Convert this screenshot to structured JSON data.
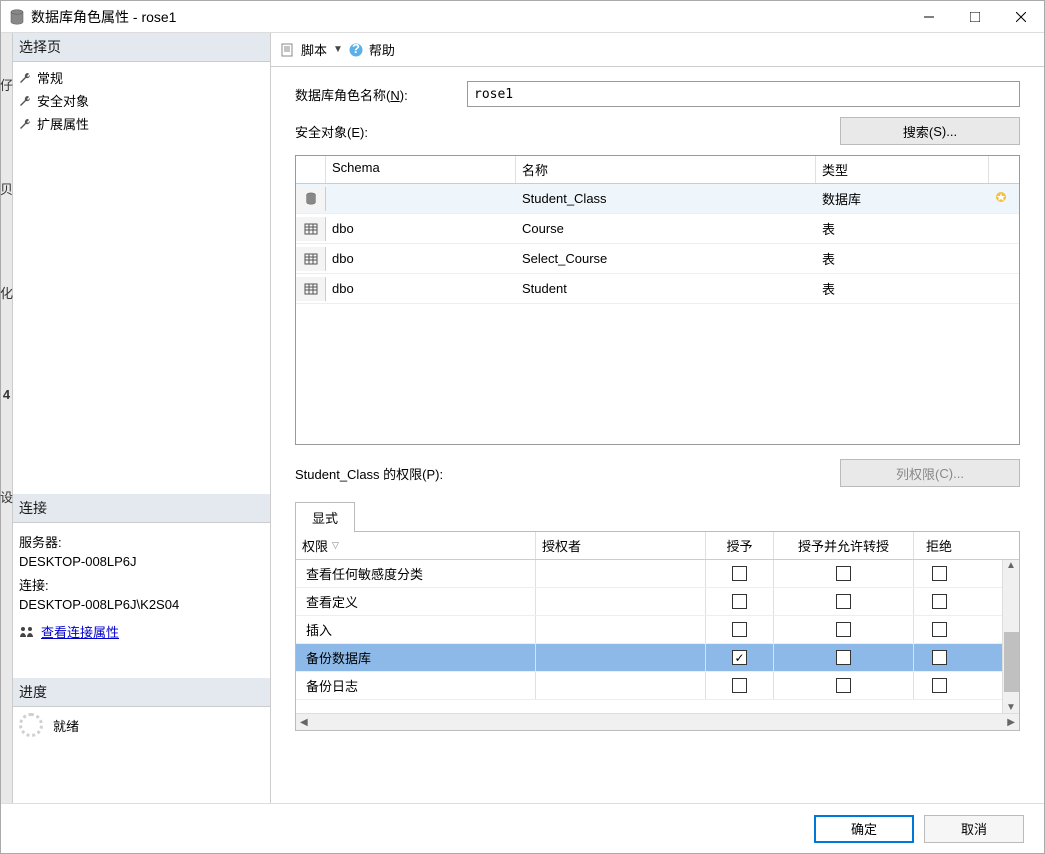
{
  "window": {
    "title": "数据库角色属性 - rose1"
  },
  "sidebar": {
    "select_page": "选择页",
    "items": [
      "常规",
      "安全对象",
      "扩展属性"
    ],
    "connection": {
      "header": "连接",
      "server_label": "服务器:",
      "server_value": "DESKTOP-008LP6J",
      "conn_label": "连接:",
      "conn_value": "DESKTOP-008LP6J\\K2S04",
      "view_props": "查看连接属性"
    },
    "progress": {
      "header": "进度",
      "status": "就绪"
    }
  },
  "toolbar": {
    "script": "脚本",
    "help": "帮助"
  },
  "form": {
    "role_name_label_prefix": "数据库角色名称(",
    "role_name_accel": "N",
    "role_name_label_suffix": "):",
    "role_name_value": "rose1",
    "securables_label_prefix": "安全对象(",
    "securables_accel": "E",
    "securables_label_suffix": "):",
    "search_btn_prefix": "搜索(",
    "search_accel": "S",
    "search_btn_suffix": ")...",
    "perm_label_prefix": "Student_Class 的权限(",
    "perm_accel": "P",
    "perm_label_suffix": "):",
    "colperm_btn_prefix": "列权限(",
    "colperm_accel": "C",
    "colperm_btn_suffix": ")..."
  },
  "grid1": {
    "headers": {
      "schema": "Schema",
      "name": "名称",
      "type": "类型"
    },
    "rows": [
      {
        "icon": "db",
        "schema": "",
        "name": "Student_Class",
        "type": "数据库",
        "selected": true,
        "extra_icon": true
      },
      {
        "icon": "table",
        "schema": "dbo",
        "name": "Course",
        "type": "表",
        "selected": false
      },
      {
        "icon": "table",
        "schema": "dbo",
        "name": "Select_Course",
        "type": "表",
        "selected": false
      },
      {
        "icon": "table",
        "schema": "dbo",
        "name": "Student",
        "type": "表",
        "selected": false
      }
    ]
  },
  "perm": {
    "tab": "显式",
    "headers": {
      "permission": "权限",
      "grantor": "授权者",
      "grant": "授予",
      "with_grant": "授予并允许转授",
      "deny": "拒绝"
    },
    "rows": [
      {
        "name": "查看任何敏感度分类",
        "grant": false,
        "with_grant": false,
        "deny": false,
        "selected": false
      },
      {
        "name": "查看定义",
        "grant": false,
        "with_grant": false,
        "deny": false,
        "selected": false
      },
      {
        "name": "插入",
        "grant": false,
        "with_grant": false,
        "deny": false,
        "selected": false
      },
      {
        "name": "备份数据库",
        "grant": true,
        "with_grant": false,
        "deny": false,
        "selected": true
      },
      {
        "name": "备份日志",
        "grant": false,
        "with_grant": false,
        "deny": false,
        "selected": false
      }
    ]
  },
  "footer": {
    "ok": "确定",
    "cancel": "取消"
  },
  "leftedge": [
    "仔",
    "贝",
    "化",
    "4",
    "设"
  ]
}
